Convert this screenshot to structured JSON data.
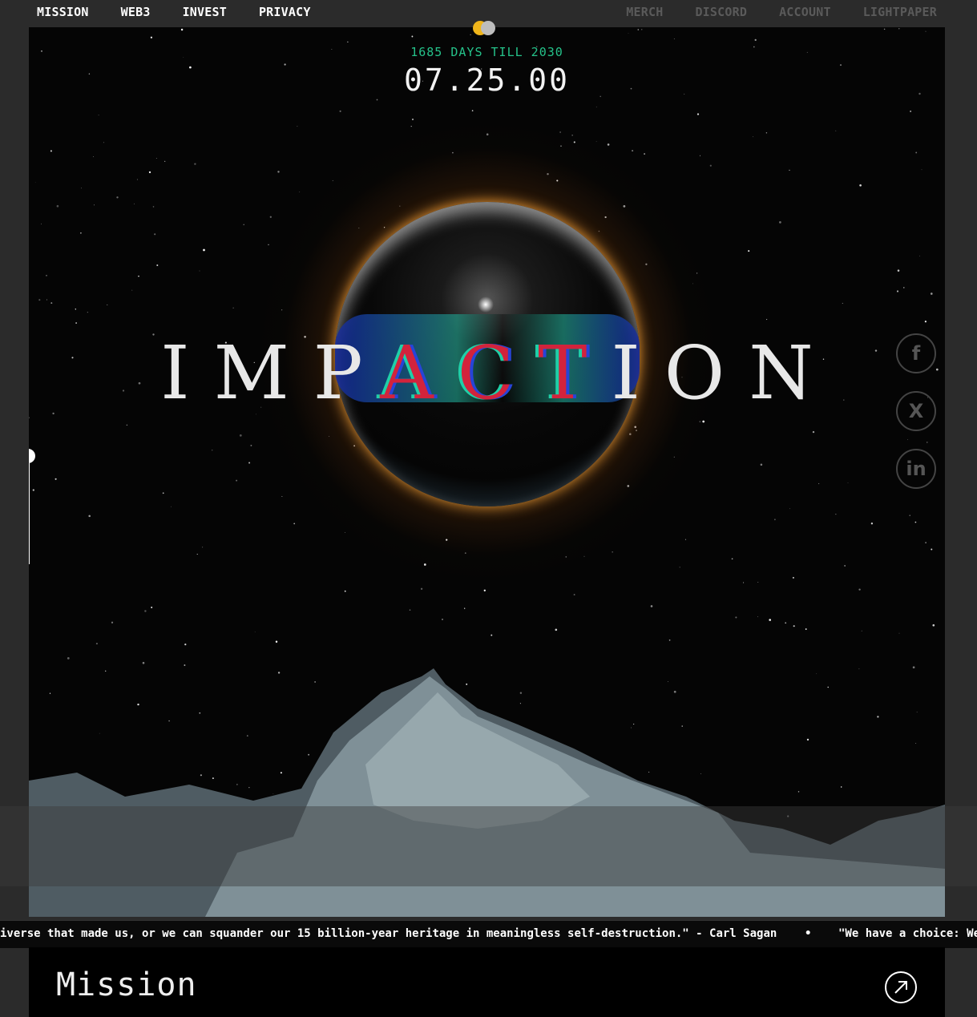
{
  "nav": {
    "left": [
      "MISSION",
      "WEB3",
      "INVEST",
      "PRIVACY"
    ],
    "right": [
      "MERCH",
      "DISCORD",
      "ACCOUNT",
      "LIGHTPAPER"
    ]
  },
  "countdown": {
    "caption": "1685 DAYS TILL 2030",
    "time": "07.25.00"
  },
  "hero": {
    "title_start": "IMP",
    "title_glitch": "ACT",
    "title_end": "ION"
  },
  "socials": {
    "facebook": "f",
    "x": "X",
    "linkedin": "in"
  },
  "ticker": {
    "text": "iverse that made us, or we can squander our 15 billion-year heritage in meaningless self-destruction.\" - Carl Sagan",
    "separator": "•",
    "next": "\"We have a choice: We"
  },
  "mission": {
    "title": "Mission"
  },
  "colors": {
    "accent_green": "#25c28a",
    "glow_orange": "#f0a030",
    "glitch_red": "#d2233c"
  }
}
